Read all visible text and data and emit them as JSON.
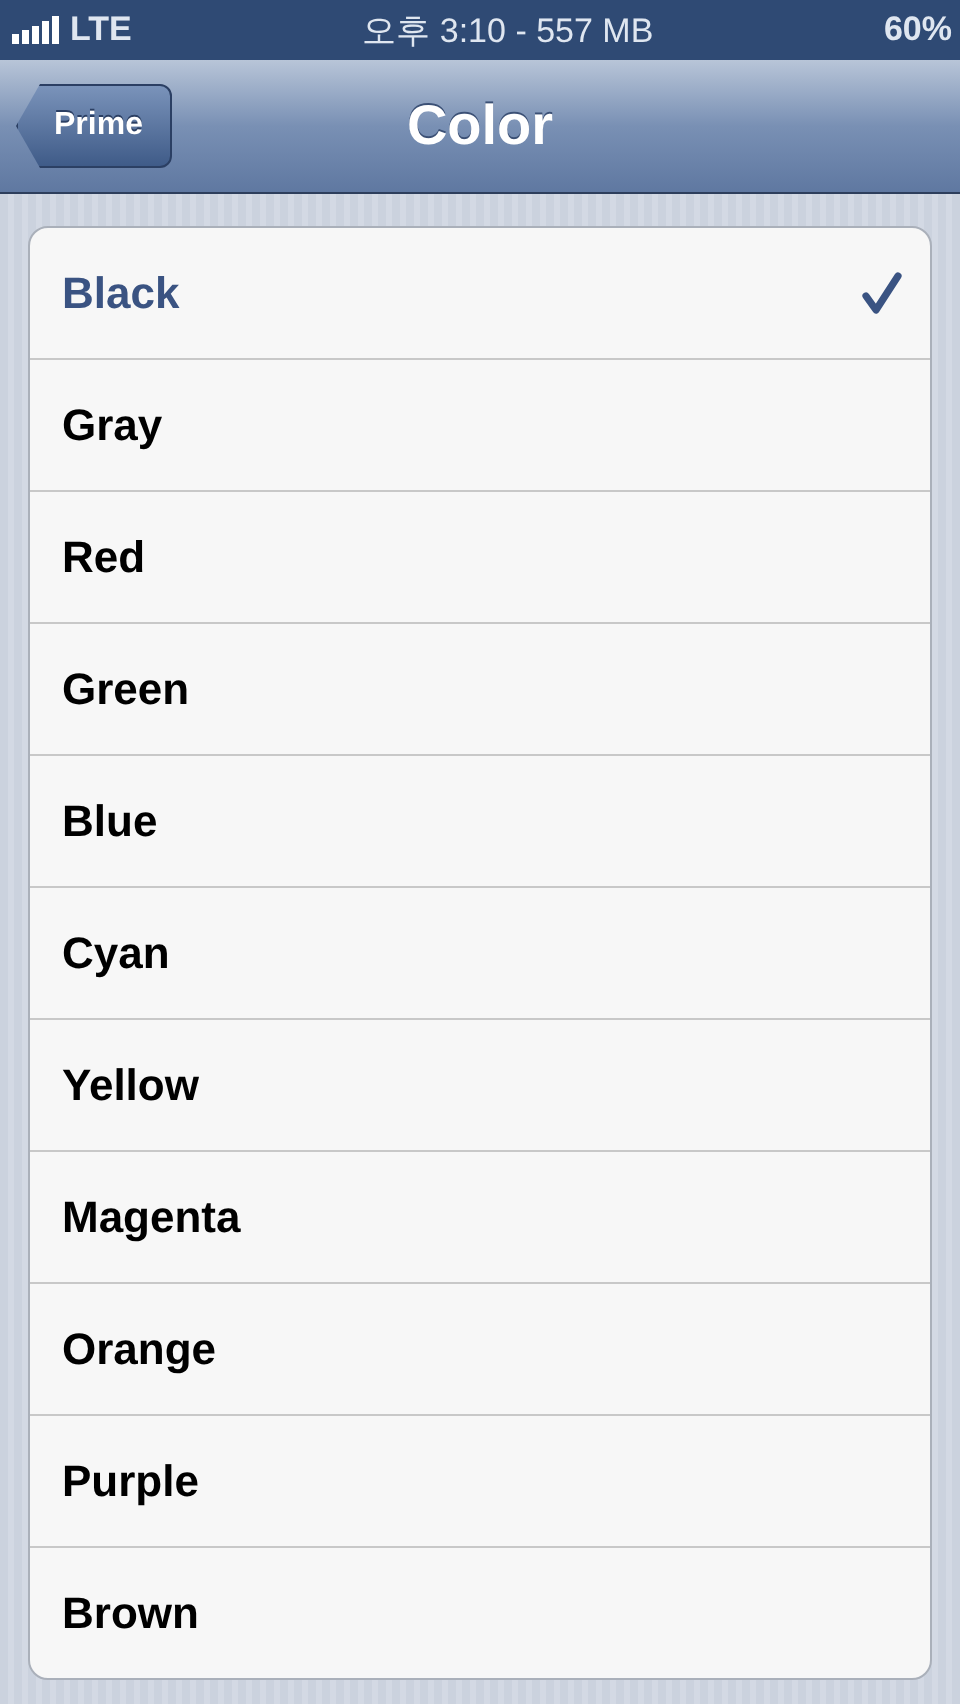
{
  "status_bar": {
    "carrier": "LTE",
    "time": "오후 3:10 - 557 MB",
    "battery": "60%"
  },
  "nav_bar": {
    "back_button": "Prime",
    "title": "Color"
  },
  "options": [
    {
      "label": "Black",
      "selected": true
    },
    {
      "label": "Gray",
      "selected": false
    },
    {
      "label": "Red",
      "selected": false
    },
    {
      "label": "Green",
      "selected": false
    },
    {
      "label": "Blue",
      "selected": false
    },
    {
      "label": "Cyan",
      "selected": false
    },
    {
      "label": "Yellow",
      "selected": false
    },
    {
      "label": "Magenta",
      "selected": false
    },
    {
      "label": "Orange",
      "selected": false
    },
    {
      "label": "Purple",
      "selected": false
    },
    {
      "label": "Brown",
      "selected": false
    }
  ]
}
